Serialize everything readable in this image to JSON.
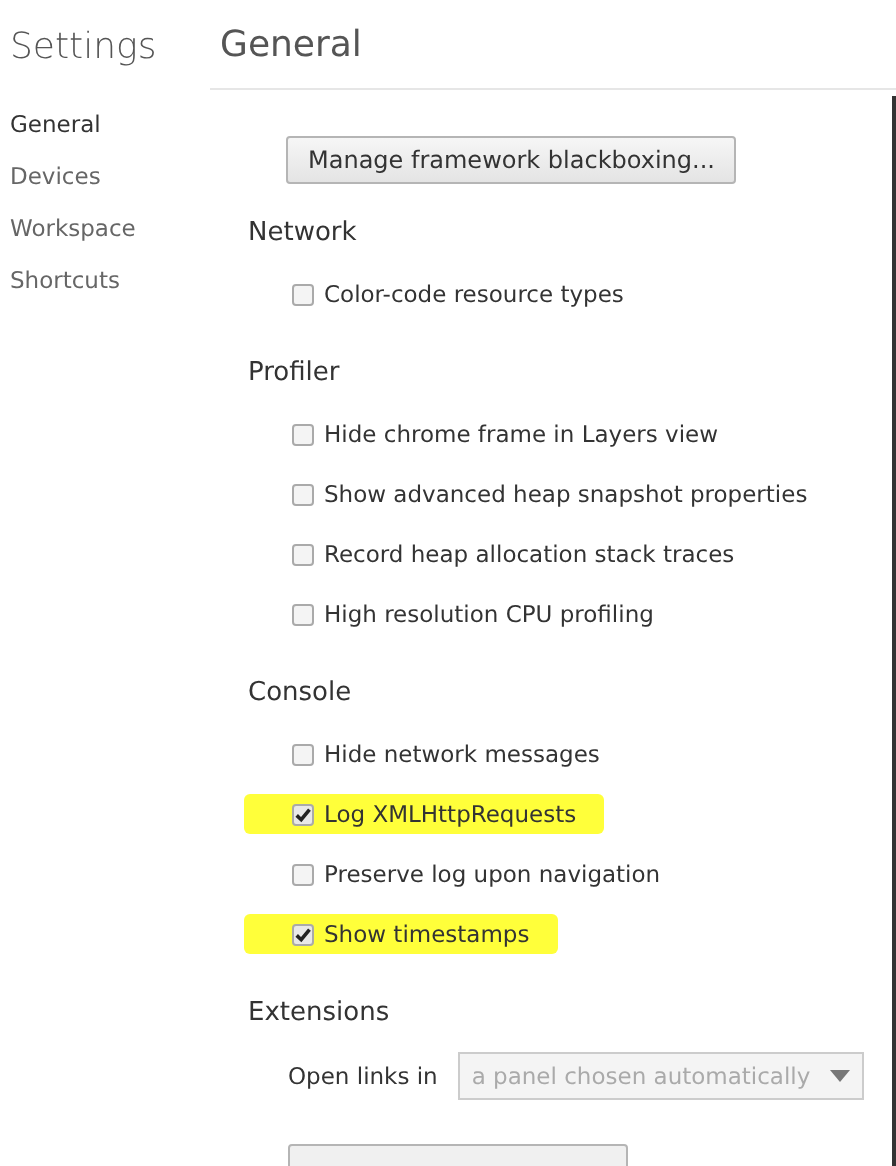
{
  "sidebar": {
    "title": "Settings",
    "items": [
      {
        "label": "General",
        "selected": true
      },
      {
        "label": "Devices",
        "selected": false
      },
      {
        "label": "Workspace",
        "selected": false
      },
      {
        "label": "Shortcuts",
        "selected": false
      }
    ]
  },
  "panel": {
    "title": "General",
    "top_button": "Manage framework blackboxing...",
    "sections": [
      {
        "title": "Network",
        "items": [
          {
            "kind": "checkbox",
            "label": "Color-code resource types",
            "checked": false,
            "highlighted": false
          }
        ]
      },
      {
        "title": "Profiler",
        "items": [
          {
            "kind": "checkbox",
            "label": "Hide chrome frame in Layers view",
            "checked": false,
            "highlighted": false
          },
          {
            "kind": "checkbox",
            "label": "Show advanced heap snapshot properties",
            "checked": false,
            "highlighted": false
          },
          {
            "kind": "checkbox",
            "label": "Record heap allocation stack traces",
            "checked": false,
            "highlighted": false
          },
          {
            "kind": "checkbox",
            "label": "High resolution CPU profiling",
            "checked": false,
            "highlighted": false
          }
        ]
      },
      {
        "title": "Console",
        "items": [
          {
            "kind": "checkbox",
            "label": "Hide network messages",
            "checked": false,
            "highlighted": false
          },
          {
            "kind": "checkbox",
            "label": "Log XMLHttpRequests",
            "checked": true,
            "highlighted": true
          },
          {
            "kind": "checkbox",
            "label": "Preserve log upon navigation",
            "checked": false,
            "highlighted": false
          },
          {
            "kind": "checkbox",
            "label": "Show timestamps",
            "checked": true,
            "highlighted": true
          }
        ]
      },
      {
        "title": "Extensions",
        "items": [
          {
            "kind": "select",
            "label": "Open links in",
            "value": "a panel chosen automatically",
            "disabled": true
          }
        ]
      }
    ]
  }
}
